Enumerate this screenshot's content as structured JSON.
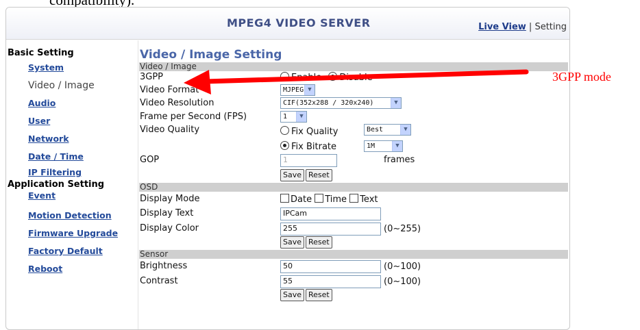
{
  "doc": {
    "caption_fragment": "compatibility)."
  },
  "header": {
    "title": "MPEG4 VIDEO SERVER",
    "nav_live": "Live View",
    "nav_sep": "|",
    "nav_setting": "Setting"
  },
  "sidebar": {
    "basic_heading": "Basic Setting",
    "basic_items": [
      {
        "label": "System",
        "active": false
      },
      {
        "label": "Video / Image",
        "active": true
      },
      {
        "label": "Audio",
        "active": false
      },
      {
        "label": "User",
        "active": false
      },
      {
        "label": "Network",
        "active": false
      },
      {
        "label": "Date / Time",
        "active": false
      },
      {
        "label": "IP Filtering",
        "active": false
      }
    ],
    "app_heading": "Application Setting",
    "app_items": [
      {
        "label": "Event"
      },
      {
        "label": "Motion Detection"
      },
      {
        "label": "Firmware Upgrade"
      },
      {
        "label": "Factory Default"
      },
      {
        "label": "Reboot"
      }
    ]
  },
  "page": {
    "title": "Video / Image Setting"
  },
  "video": {
    "section": "Video / Image",
    "gpp_label": "3GPP",
    "enable_label": "Enable",
    "disable_label": "Disable",
    "gpp_selected": "Disable",
    "format_label": "Video Format",
    "format_value": "MJPEG",
    "resolution_label": "Video Resolution",
    "resolution_value": "CIF(352x288 / 320x240)",
    "fps_label": "Frame per Second (FPS)",
    "fps_value": "1",
    "quality_label": "Video Quality",
    "fix_quality_label": "Fix Quality",
    "fix_quality_value": "Best",
    "fix_bitrate_label": "Fix Bitrate",
    "fix_bitrate_value": "1M",
    "quality_selected": "Fix Bitrate",
    "gop_label": "GOP",
    "gop_value": "1",
    "gop_unit": "frames"
  },
  "osd": {
    "section": "OSD",
    "mode_label": "Display Mode",
    "opt_date": "Date",
    "opt_time": "Time",
    "opt_text": "Text",
    "text_label": "Display Text",
    "text_value": "IPCam",
    "color_label": "Display Color",
    "color_value": "255",
    "color_range": "(0~255)"
  },
  "sensor": {
    "section": "Sensor",
    "brightness_label": "Brightness",
    "brightness_value": "50",
    "brightness_range": "(0~100)",
    "contrast_label": "Contrast",
    "contrast_value": "55",
    "contrast_range": "(0~100)"
  },
  "buttons": {
    "save": "Save",
    "reset": "Reset"
  },
  "annotation": {
    "text": "3GPP mode",
    "color": "#ff0000"
  }
}
